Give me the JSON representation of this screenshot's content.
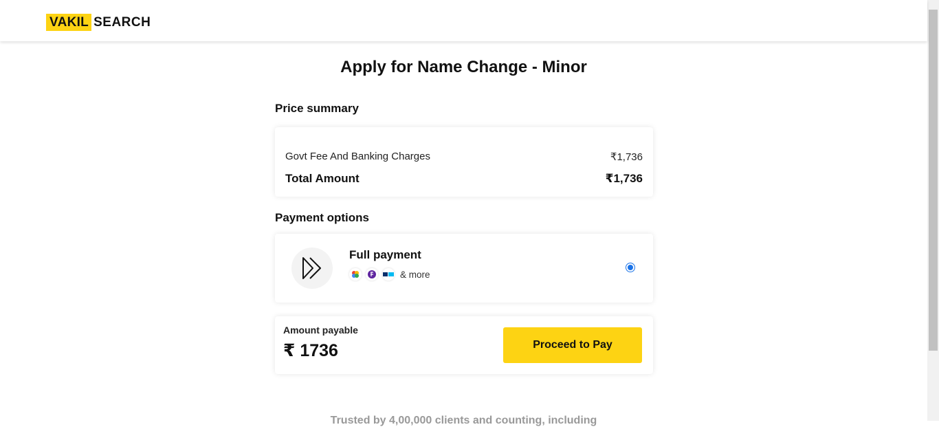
{
  "header": {
    "logo_part1": "VAKIL",
    "logo_part2": "SEARCH"
  },
  "page_title": "Apply for Name Change - Minor",
  "price_summary": {
    "heading": "Price summary",
    "fee_label": "Govt Fee And Banking Charges",
    "fee_value": "₹1,736",
    "total_label": "Total Amount",
    "total_value": "₹1,736"
  },
  "payment_options": {
    "heading": "Payment options",
    "option_title": "Full payment",
    "methods": [
      "google-pay-icon",
      "phonepe-icon",
      "paytm-icon"
    ],
    "more_text": "& more",
    "selected": true
  },
  "checkout": {
    "amount_label": "Amount payable",
    "amount_value": "₹ 1736",
    "button_label": "Proceed to Pay"
  },
  "footer": {
    "trusted_text": "Trusted by 4,00,000 clients and counting, including"
  },
  "colors": {
    "brand_yellow": "#fdd313",
    "radio_blue": "#1a73e8"
  }
}
